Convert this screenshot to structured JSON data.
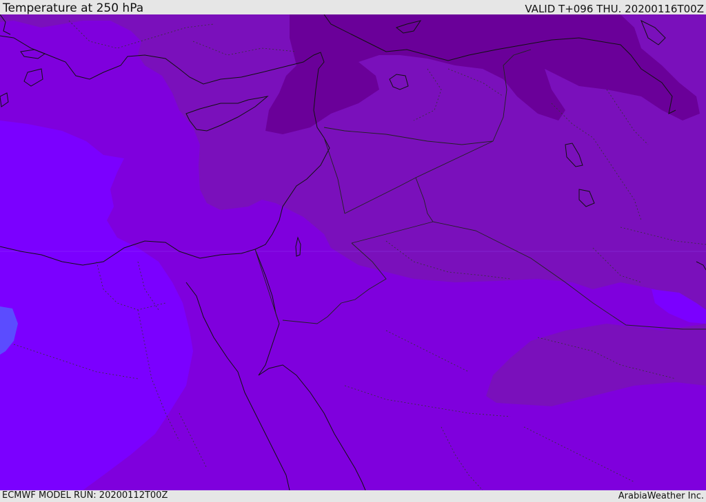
{
  "header": {
    "title": "Temperature at 250 hPa",
    "valid_time": "VALID T+096 THU. 20200116T00Z"
  },
  "footer": {
    "model_run": "ECMWF MODEL RUN: 20200112T00Z",
    "credit": "ArabiaWeather Inc."
  },
  "map": {
    "colors": {
      "band_warmest": "#5b4cff",
      "band_warm": "#7b00ff",
      "band_mid": "#7f00dd",
      "band_cool": "#7a10bb",
      "band_coolest": "#6a0099",
      "coastline": "#111111",
      "border": "#222222"
    }
  }
}
